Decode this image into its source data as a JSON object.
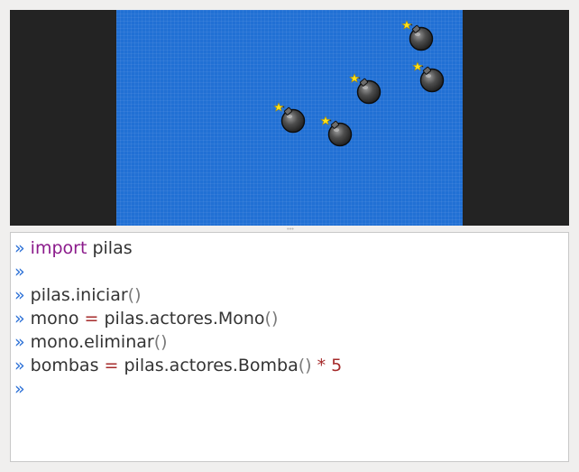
{
  "console": {
    "prompt": "»",
    "lines": [
      {
        "tokens": [
          {
            "kind": "kw",
            "text": "import"
          },
          {
            "kind": "plain",
            "text": " pilas"
          }
        ]
      },
      {
        "tokens": []
      },
      {
        "tokens": [
          {
            "kind": "plain",
            "text": "pilas.iniciar"
          },
          {
            "kind": "paren",
            "text": "()"
          }
        ]
      },
      {
        "tokens": [
          {
            "kind": "plain",
            "text": "mono "
          },
          {
            "kind": "op",
            "text": "="
          },
          {
            "kind": "plain",
            "text": " pilas.actores.Mono"
          },
          {
            "kind": "paren",
            "text": "()"
          }
        ]
      },
      {
        "tokens": [
          {
            "kind": "plain",
            "text": "mono.eliminar"
          },
          {
            "kind": "paren",
            "text": "()"
          }
        ]
      },
      {
        "tokens": [
          {
            "kind": "plain",
            "text": "bombas "
          },
          {
            "kind": "op",
            "text": "="
          },
          {
            "kind": "plain",
            "text": " pilas.actores.Bomba"
          },
          {
            "kind": "paren",
            "text": "()"
          },
          {
            "kind": "op",
            "text": " * "
          },
          {
            "kind": "num",
            "text": "5"
          }
        ]
      },
      {
        "tokens": []
      }
    ]
  },
  "stage": {
    "background_color": "#2170d4",
    "frame_color": "#232323",
    "actors": [
      {
        "icon": "bomb-icon"
      },
      {
        "icon": "bomb-icon"
      },
      {
        "icon": "bomb-icon"
      },
      {
        "icon": "bomb-icon"
      },
      {
        "icon": "bomb-icon"
      }
    ]
  },
  "colors": {
    "prompt": "#2a6fd6",
    "keyword": "#8b1a8b",
    "operator": "#a52a2a",
    "paren": "#7a7a7a",
    "text": "#333333"
  }
}
